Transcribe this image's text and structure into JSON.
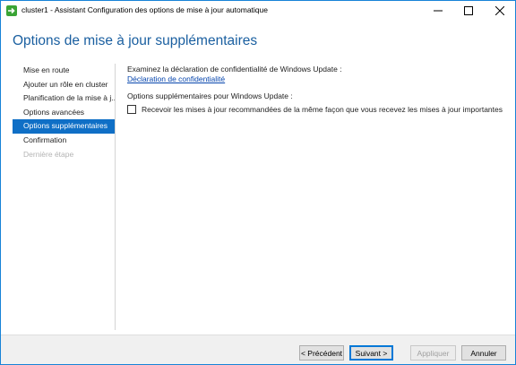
{
  "window": {
    "title": "cluster1 - Assistant Configuration des options de mise à jour automatique",
    "controls": [
      "minimize",
      "maximize",
      "close"
    ]
  },
  "header": {
    "title": "Options de mise à jour supplémentaires"
  },
  "nav": {
    "items": [
      {
        "label": "Mise en route",
        "state": "normal"
      },
      {
        "label": "Ajouter un rôle en cluster",
        "state": "normal"
      },
      {
        "label": "Planification de la mise à j...",
        "state": "normal"
      },
      {
        "label": "Options avancées",
        "state": "normal"
      },
      {
        "label": "Options supplémentaires",
        "state": "active"
      },
      {
        "label": "Confirmation",
        "state": "normal"
      },
      {
        "label": "Dernière étape",
        "state": "disabled"
      }
    ]
  },
  "main": {
    "privacy_prompt": "Examinez la déclaration de confidentialité de Windows Update :",
    "privacy_link": "Déclaration de confidentialité",
    "options_heading": "Options supplémentaires pour Windows Update :",
    "recommended_checkbox": {
      "label": "Recevoir les mises à jour recommandées de la même façon que vous recevez les mises à jour importantes",
      "checked": false
    }
  },
  "footer": {
    "prev_label": "< Précédent",
    "next_label": "Suivant >",
    "apply_label": "Appliquer",
    "cancel_label": "Annuler"
  },
  "colors": {
    "accent": "#0f6fc6",
    "title_blue": "#1a5fa0",
    "link": "#0645ad",
    "window_border": "#1883d7"
  }
}
